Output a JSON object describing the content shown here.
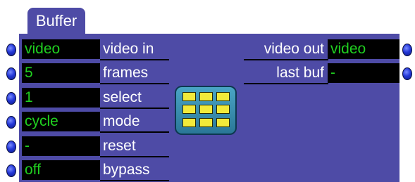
{
  "actor": {
    "title": "Buffer",
    "inputs": [
      {
        "label": "video in",
        "value": "video"
      },
      {
        "label": "frames",
        "value": "5"
      },
      {
        "label": "select",
        "value": "1"
      },
      {
        "label": "mode",
        "value": "cycle"
      },
      {
        "label": "reset",
        "value": "-"
      },
      {
        "label": "bypass",
        "value": "off"
      }
    ],
    "outputs": [
      {
        "label": "video out",
        "value": "video"
      },
      {
        "label": "last buf",
        "value": "-"
      }
    ],
    "icon": "buffer-grid-icon",
    "colors": {
      "body": "#4e4ba6",
      "value_text": "#20d020",
      "value_bg": "#000000",
      "label_text": "#ffffff",
      "port": "#2438d8",
      "icon_bg": "#2a7797",
      "icon_cells": "#f2ea3a"
    }
  }
}
